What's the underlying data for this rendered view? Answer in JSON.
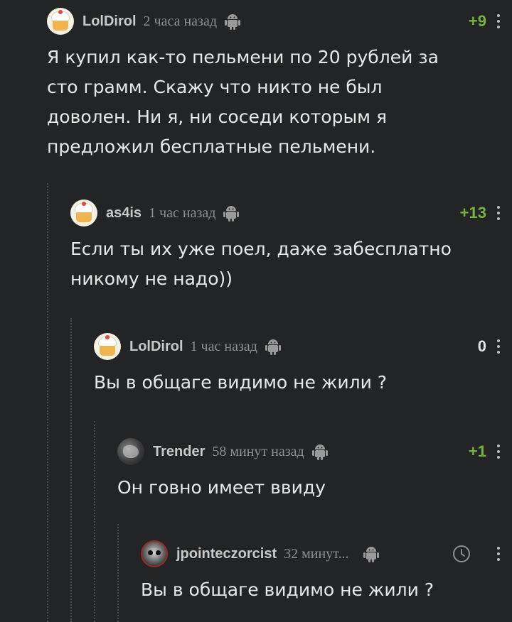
{
  "comments": [
    {
      "username": "LolDirol",
      "time": "2 часа назад",
      "score": "+9",
      "avatar": "cake-avatar",
      "text": "Я купил как-то пельмени по 20 рублей за\nсто грамм. Скажу что никто не был\nдоволен. Ни я, ни соседи которым я\nпредложил бесплатные пельмени."
    },
    {
      "username": "as4is",
      "time": "1 час назад",
      "score": "+13",
      "avatar": "cake-avatar",
      "text": "Если ты их уже поел, даже забесплатно\nникому не надо))"
    },
    {
      "username": "LolDirol",
      "time": "1 час назад",
      "score": "0",
      "avatar": "cake-avatar",
      "text": "Вы в общаге видимо не жили ?"
    },
    {
      "username": "Trender",
      "time": "58 минут назад",
      "score": "+1",
      "avatar": "photo-avatar",
      "text": "Он говно имеет ввиду"
    },
    {
      "username": "jpointeczorcist",
      "time": "32 минут...",
      "score": "",
      "avatar": "skull-avatar",
      "text": "Вы в общаге видимо не жили ?"
    }
  ],
  "icons": {
    "platform": "android-icon",
    "menu": "more-vertical-icon",
    "pending": "clock-icon"
  },
  "colors": {
    "background": "#232425",
    "positive_score": "#7ab33a",
    "username": "#c9c9c9",
    "timestamp": "#8f8f8f",
    "text": "#e8e8e8"
  }
}
